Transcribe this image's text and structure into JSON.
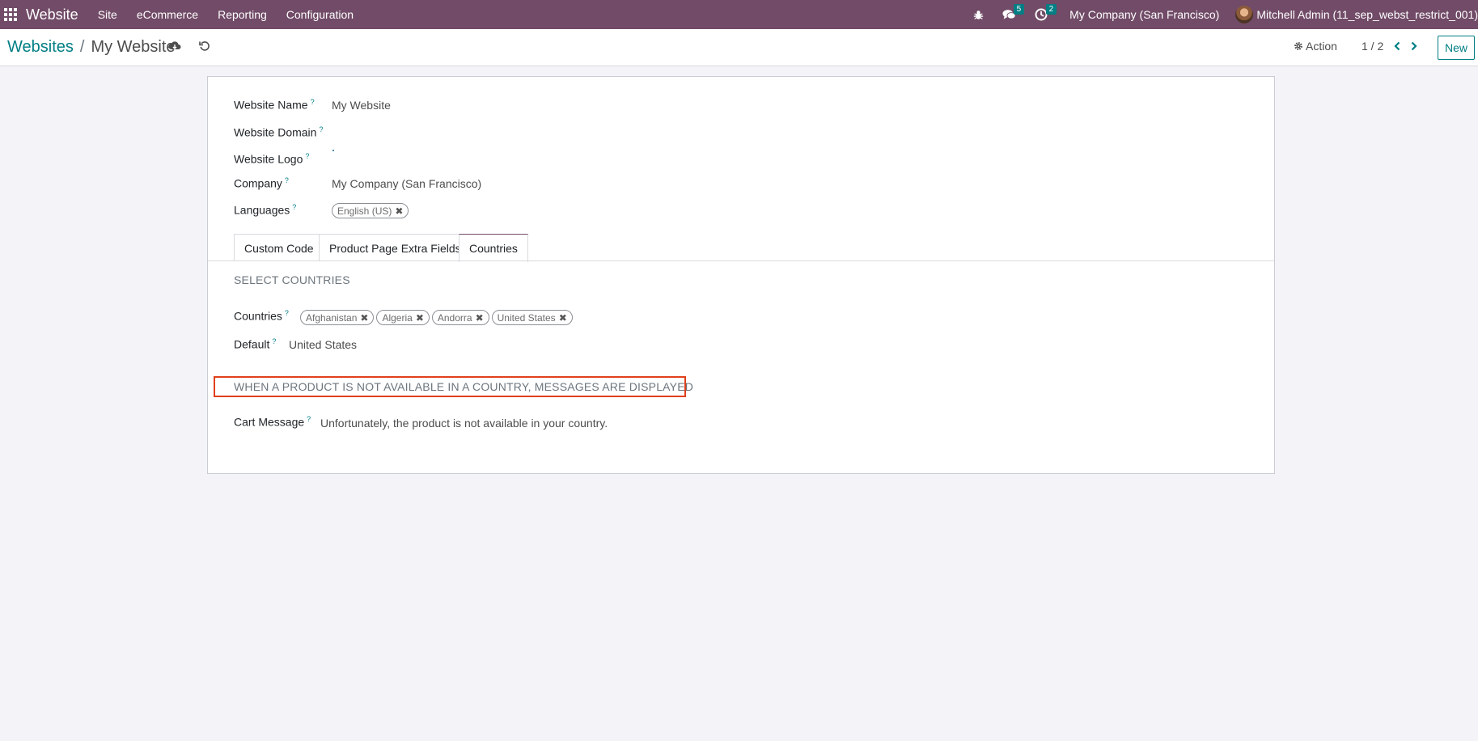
{
  "navbar": {
    "brand": "Website",
    "menu": [
      "Site",
      "eCommerce",
      "Reporting",
      "Configuration"
    ],
    "messages_count": "5",
    "activities_count": "2",
    "company": "My Company (San Francisco)",
    "user": "Mitchell Admin (11_sep_webst_restrict_001)"
  },
  "breadcrumb": {
    "parent": "Websites",
    "separator": "/",
    "current": "My Website"
  },
  "control": {
    "action_label": "Action",
    "pager": "1 / 2",
    "new_label": "New"
  },
  "form": {
    "website_name_label": "Website Name",
    "website_name_value": "My Website",
    "website_domain_label": "Website Domain",
    "website_logo_label": "Website Logo",
    "company_label": "Company",
    "company_value": "My Company (San Francisco)",
    "languages_label": "Languages",
    "languages": [
      "English (US)"
    ],
    "help_mark": "?"
  },
  "tabs": [
    "Custom Code",
    "Product Page Extra Fields",
    "Countries"
  ],
  "countries_tab": {
    "section_select": "SELECT COUNTRIES",
    "countries_label": "Countries",
    "countries": [
      "Afghanistan",
      "Algeria",
      "Andorra",
      "United States"
    ],
    "default_label": "Default",
    "default_value": "United States",
    "section_messages": "WHEN A PRODUCT IS NOT AVAILABLE IN A COUNTRY, MESSAGES ARE DISPLAYED",
    "cart_message_label": "Cart Message",
    "cart_message_value": "Unfortunately, the product is not available in your country."
  },
  "colors": {
    "navbar": "#714b67",
    "accent": "#017e84",
    "highlight_box": "#e0401c"
  }
}
